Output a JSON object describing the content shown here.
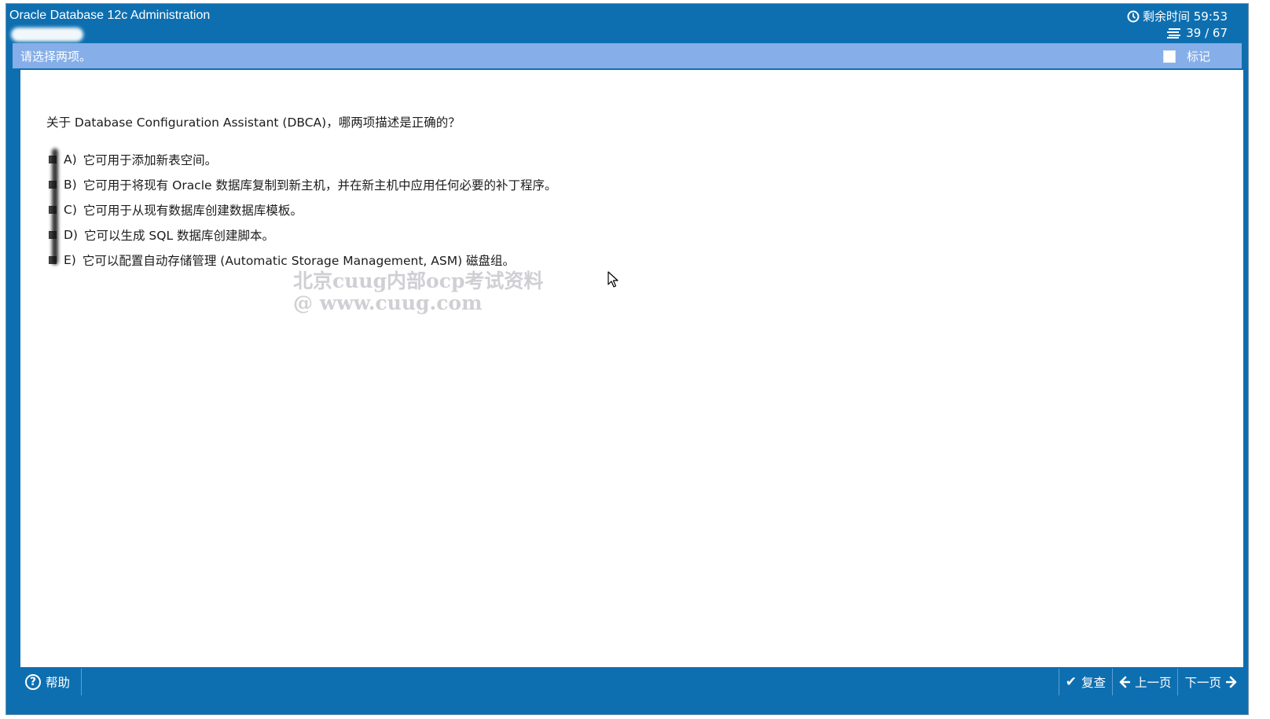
{
  "window": {
    "title": "Oracle Database 12c Administration"
  },
  "header": {
    "timer_label": "剩余时间 59:53",
    "progress_label": "39 / 67"
  },
  "instruction_bar": {
    "text": "请选择两项。",
    "mark_label": "标记"
  },
  "question": {
    "text": "关于 Database Configuration Assistant (DBCA)，哪两项描述是正确的？",
    "options": [
      {
        "letter": "A)",
        "text": "它可用于添加新表空间。"
      },
      {
        "letter": "B)",
        "text": "它可用于将现有 Oracle 数据库复制到新主机，并在新主机中应用任何必要的补丁程序。"
      },
      {
        "letter": "C)",
        "text": "它可用于从现有数据库创建数据库模板。"
      },
      {
        "letter": "D)",
        "text": "它可以生成 SQL 数据库创建脚本。"
      },
      {
        "letter": "E)",
        "text": "它可以配置自动存储管理 (Automatic Storage Management, ASM) 磁盘组。"
      }
    ]
  },
  "watermark": {
    "line1": "北京cuug内部ocp考试资料",
    "line2": "@ www.cuug.com"
  },
  "footer": {
    "help_label": "帮助",
    "review_label": "复查",
    "prev_label": "上一页",
    "next_label": "下一页"
  },
  "colors": {
    "frame_blue": "#0e6fb0",
    "instruction_bar": "#86aee8",
    "content_bg": "#ffffff"
  },
  "icons": {
    "timer": "clock-icon",
    "progress": "list-icon",
    "help": "question-circle-icon",
    "review": "checkmark-icon",
    "prev": "arrow-left-icon",
    "next": "arrow-right-icon"
  }
}
